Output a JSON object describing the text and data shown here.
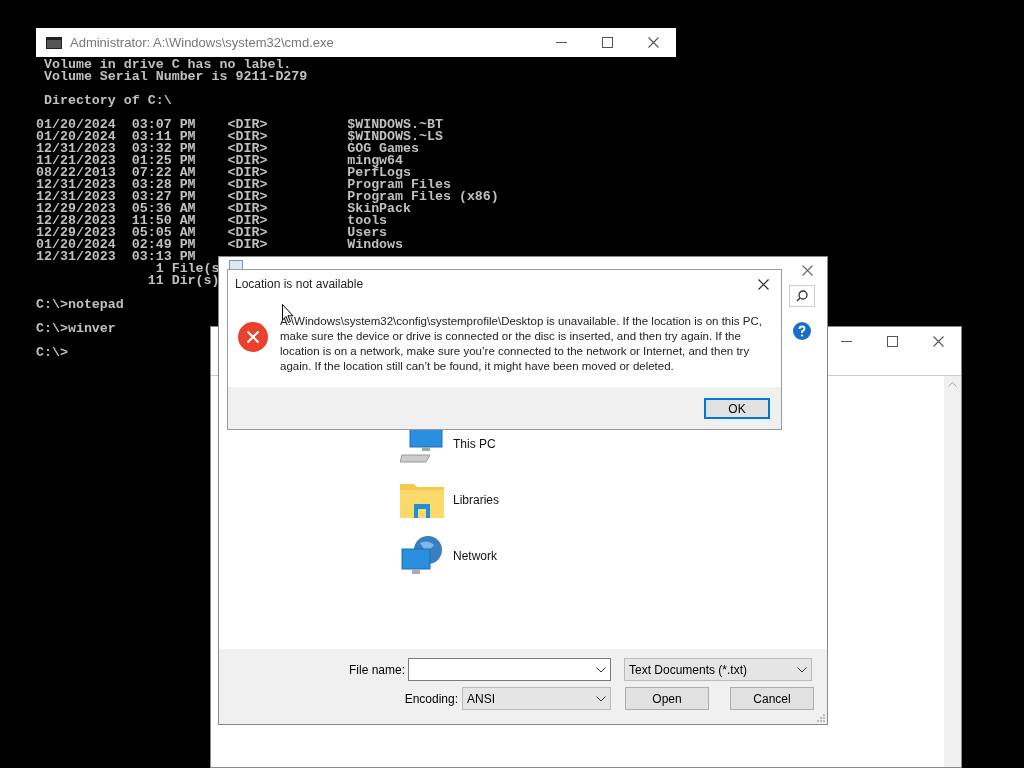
{
  "cmd_window": {
    "title": "Administrator: A:\\Windows\\system32\\cmd.exe",
    "console_blocks": [
      [
        " Volume in drive C has no label.",
        " Volume Serial Number is 9211-D279"
      ],
      [
        " Directory of C:\\"
      ],
      [
        "01/20/2024  03:07 PM    <DIR>          $WINDOWS.~BT",
        "01/20/2024  03:11 PM    <DIR>          $WINDOWS.~LS",
        "12/31/2023  03:32 PM    <DIR>          GOG Games",
        "11/21/2023  01:25 PM    <DIR>          mingw64",
        "08/22/2013  07:22 AM    <DIR>          PerfLogs",
        "12/31/2023  03:28 PM    <DIR>          Program Files",
        "12/31/2023  03:27 PM    <DIR>          Program Files (x86)",
        "12/29/2023  05:36 AM    <DIR>          SkinPack",
        "12/28/2023  11:50 AM    <DIR>          tools",
        "12/29/2023  05:05 AM    <DIR>          Users",
        "01/20/2024  02:49 PM    <DIR>          Windows",
        "12/31/2023  03:13 PM",
        "               1 File(s",
        "              11 Dir(s)"
      ],
      [
        "C:\\>notepad"
      ],
      [
        "C:\\>winver"
      ],
      [
        "C:\\>"
      ]
    ]
  },
  "open_dialog": {
    "places": [
      {
        "label": "This PC",
        "kind": "computer"
      },
      {
        "label": "Libraries",
        "kind": "library"
      },
      {
        "label": "Network",
        "kind": "network"
      }
    ],
    "file_name_label": "File name:",
    "file_type": "Text Documents (*.txt)",
    "encoding_label": "Encoding:",
    "encoding": "ANSI",
    "buttons": [
      "Open",
      "Cancel"
    ]
  },
  "error_dialog": {
    "title": "Location is not available",
    "message": "A:\\Windows\\system32\\config\\systemprofile\\Desktop is unavailable. If the location is on this PC, make sure the device or drive is connected or the disc is inserted, and then try again. If the location is on a network, make sure you’re connected to the network or Internet, and then try again. If the location still can’t be found, it might have been moved or deleted.",
    "button": "OK"
  }
}
